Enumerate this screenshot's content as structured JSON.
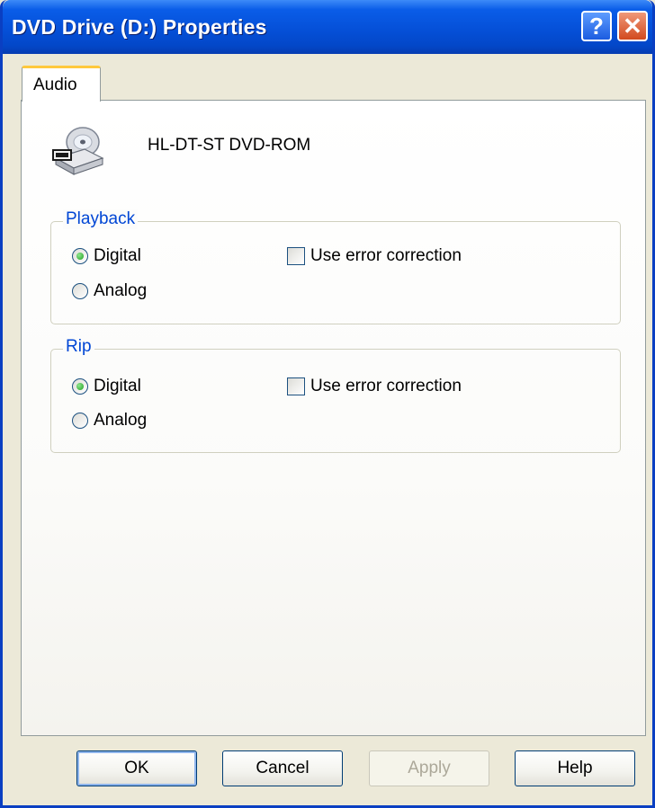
{
  "window": {
    "title": "DVD Drive (D:) Properties"
  },
  "titlebar": {
    "help_glyph": "?",
    "close_glyph": "✕"
  },
  "tabs": [
    {
      "label": "Audio"
    }
  ],
  "device": {
    "icon": "dvd-drive-icon",
    "name": "HL-DT-ST DVD-ROM"
  },
  "playback": {
    "legend": "Playback",
    "digital_label": "Digital",
    "analog_label": "Analog",
    "selected": "Digital",
    "error_correction_label": "Use error correction",
    "error_correction_checked": false
  },
  "rip": {
    "legend": "Rip",
    "digital_label": "Digital",
    "analog_label": "Analog",
    "selected": "Digital",
    "error_correction_label": "Use error correction",
    "error_correction_checked": false
  },
  "buttons": {
    "ok": "OK",
    "cancel": "Cancel",
    "apply": "Apply",
    "help": "Help"
  },
  "colors": {
    "title_bar": "#0550D8",
    "group_legend": "#0046D5",
    "tab_highlight": "#FFC83C"
  }
}
